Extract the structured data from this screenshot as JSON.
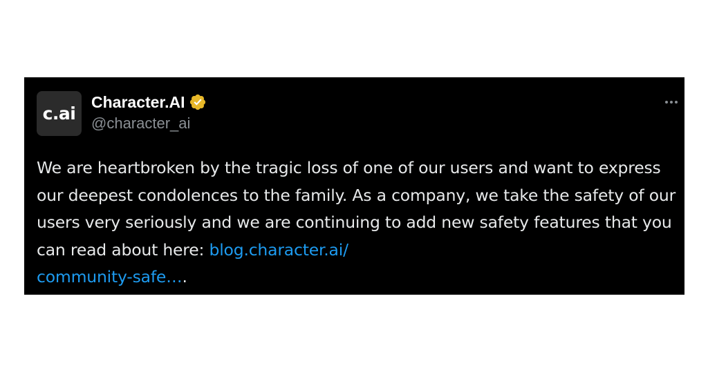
{
  "tweet": {
    "avatar_text": "c.ai",
    "display_name": "Character.AI",
    "handle": "@character_ai",
    "verified_icon": "verified-badge-gold",
    "more_icon": "more-horizontal",
    "body_text_1": "We are heartbroken by the tragic loss of one of our users and want to express our deepest condolences to the family. As a company, we take the safety of our users very seriously and we are continuing to add new safety features that you can read about here: ",
    "link_line_1": "blog.character.ai/",
    "link_line_2": "community-safe…",
    "body_text_end": ".",
    "colors": {
      "card_background": "#000000",
      "text": "#e7e9ea",
      "handle": "#8a8f94",
      "link": "#1d9bf0",
      "verified": "#e8b829"
    }
  }
}
